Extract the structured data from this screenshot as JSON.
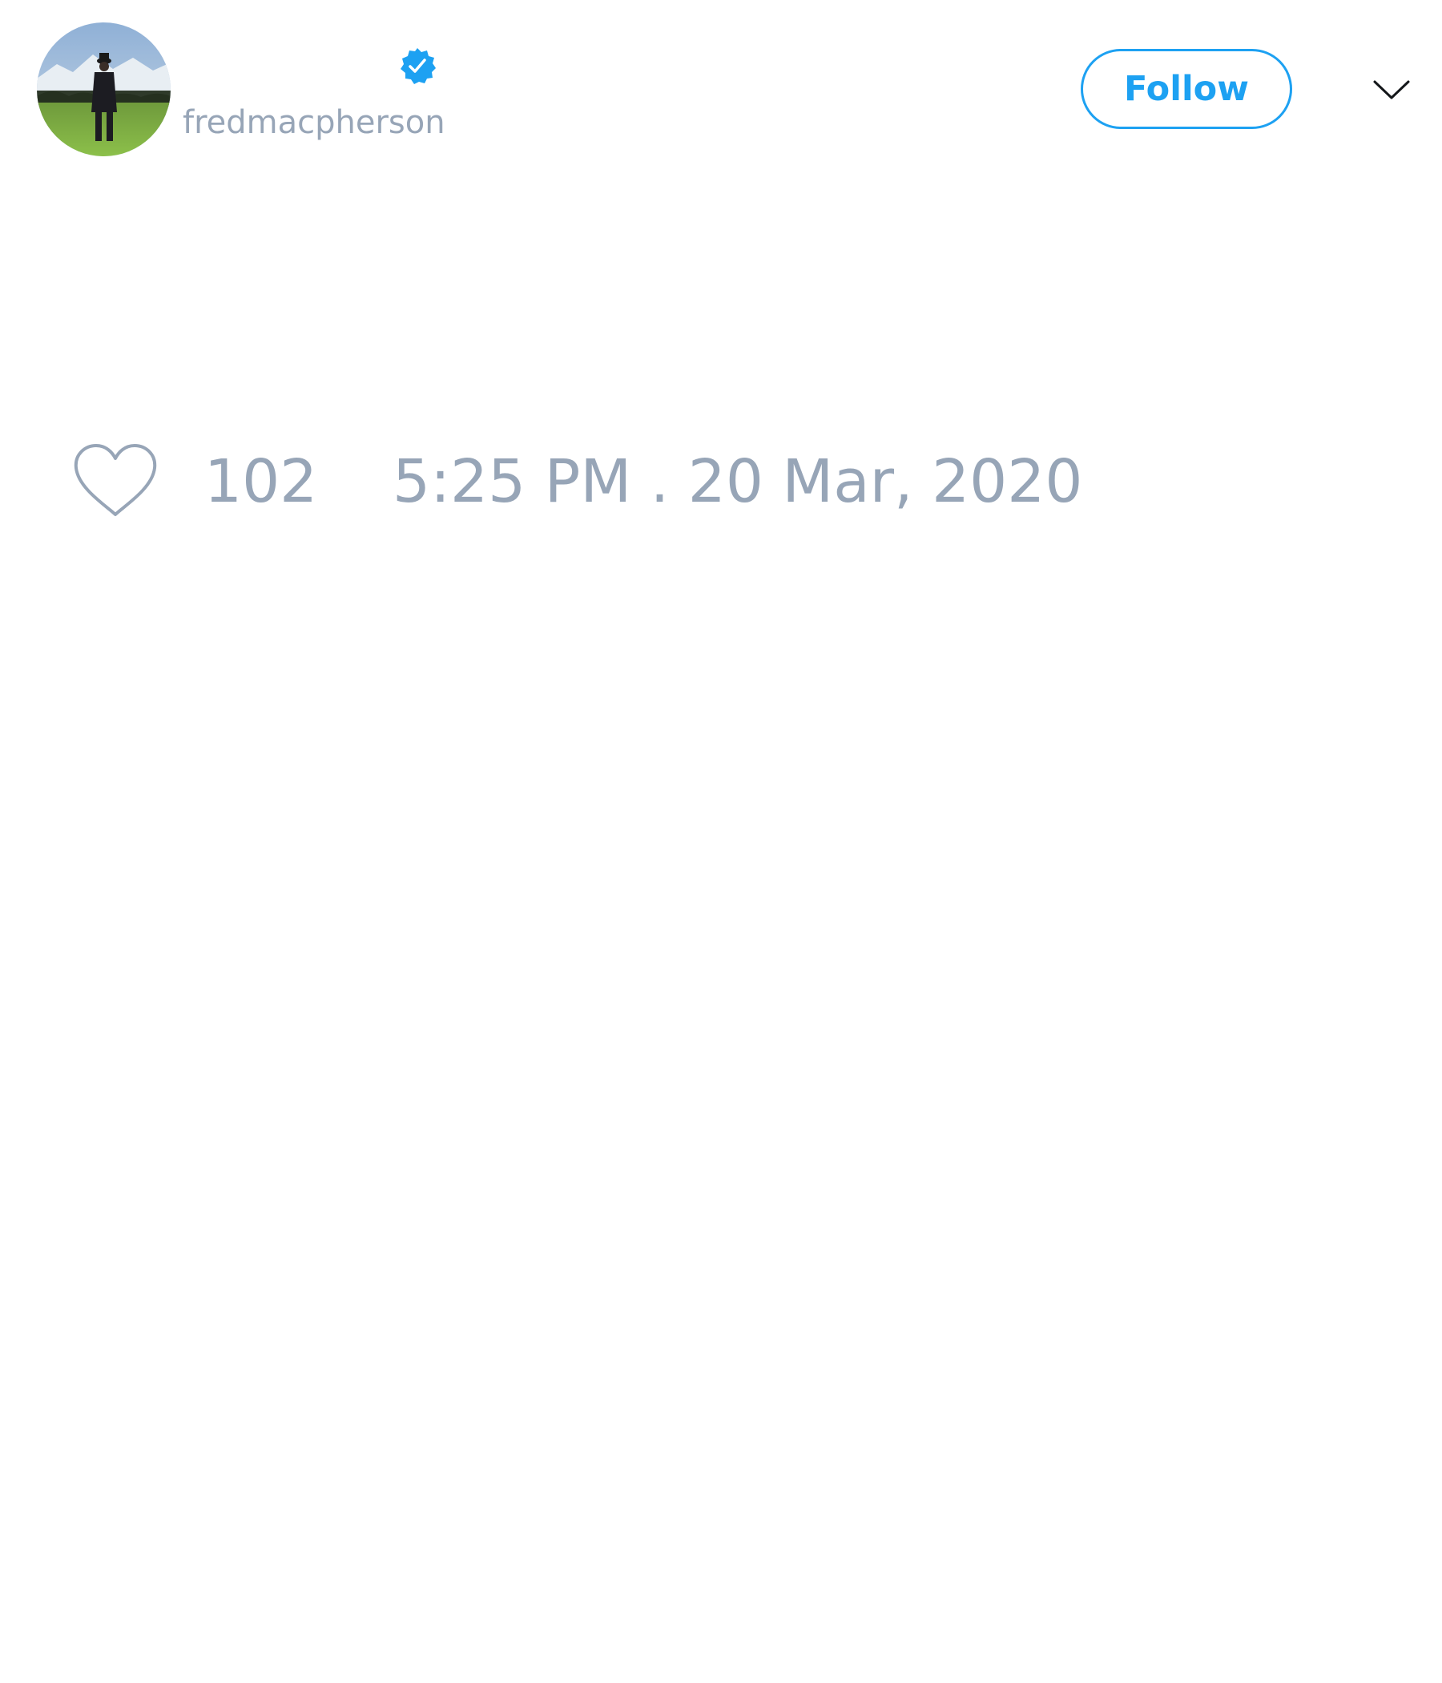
{
  "tweet": {
    "author": {
      "display_name": "",
      "handle": "fredmacpherson",
      "verified": true,
      "avatar_icon": "avatar-photo-man-in-field"
    },
    "follow_label": "Follow",
    "menu_icon": "chevron-down-icon",
    "like_icon": "heart-icon",
    "like_count": "102",
    "timestamp": "5:25 PM . 20 Mar, 2020"
  },
  "colors": {
    "accent": "#1da1f2",
    "muted_text": "#97a5b7",
    "background": "#ffffff"
  }
}
